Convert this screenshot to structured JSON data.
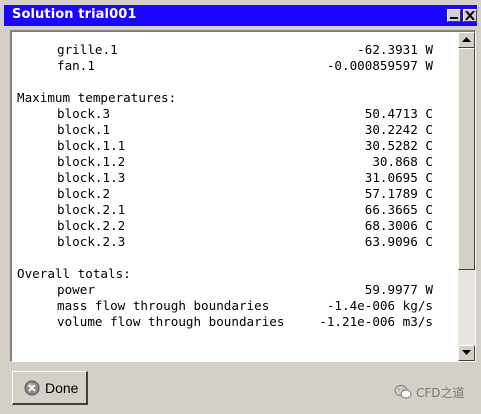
{
  "window": {
    "title": "Solution trial001"
  },
  "output": {
    "lines": [
      {
        "kind": "row",
        "label": "grille.1",
        "value": "-62.3931 W"
      },
      {
        "kind": "row",
        "label": "fan.1",
        "value": "-0.000859597 W"
      },
      {
        "kind": "blank"
      },
      {
        "kind": "heading",
        "label": "Maximum temperatures:"
      },
      {
        "kind": "row",
        "label": "block.3",
        "value": "50.4713 C"
      },
      {
        "kind": "row",
        "label": "block.1",
        "value": "30.2242 C"
      },
      {
        "kind": "row",
        "label": "block.1.1",
        "value": "30.5282 C"
      },
      {
        "kind": "row",
        "label": "block.1.2",
        "value": "30.868 C"
      },
      {
        "kind": "row",
        "label": "block.1.3",
        "value": "31.0695 C"
      },
      {
        "kind": "row",
        "label": "block.2",
        "value": "57.1789 C"
      },
      {
        "kind": "row",
        "label": "block.2.1",
        "value": "66.3665 C"
      },
      {
        "kind": "row",
        "label": "block.2.2",
        "value": "68.3006 C"
      },
      {
        "kind": "row",
        "label": "block.2.3",
        "value": "63.9096 C"
      },
      {
        "kind": "blank"
      },
      {
        "kind": "heading",
        "label": "Overall totals:"
      },
      {
        "kind": "row",
        "label": "power",
        "value": "59.9977 W"
      },
      {
        "kind": "row",
        "label": "mass flow through boundaries",
        "value": "-1.4e-006 kg/s"
      },
      {
        "kind": "row",
        "label": "volume flow through boundaries",
        "value": "-1.21e-006 m3/s"
      }
    ]
  },
  "footer": {
    "done_label": "Done",
    "watermark_text": "CFD之道"
  },
  "icons": {
    "minimize": "minimize-icon",
    "close": "close-icon",
    "scroll_up": "arrow-up-icon",
    "scroll_down": "arrow-down-icon",
    "done": "x-circle-icon",
    "watermark": "wechat-icon"
  },
  "colors": {
    "titlebar": "#1a06ff",
    "title_text": "#ffffff",
    "window_bg": "#d4d0c8",
    "content_bg": "#ffffff"
  }
}
